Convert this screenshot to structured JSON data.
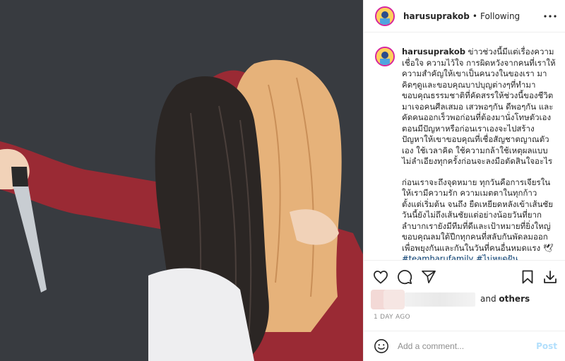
{
  "colors": {
    "accent": "#0095f6",
    "post_disabled": "#b2dffc",
    "muted": "#8e8e8e",
    "divider": "#efefef",
    "image_bg": "#383b40"
  },
  "post": {
    "image_alt": "illustration",
    "icons": [
      "knife-illustration"
    ]
  },
  "header": {
    "username": "harusuprakob",
    "separator": "•",
    "follow_status": "Following",
    "more_icon": "more-horizontal-icon"
  },
  "caption": {
    "username": "harusuprakob",
    "paragraph1": "ข่าวช่วงนี้มีแต่เรื่องความเชื่อใจ ความไว้ใจ การผิดหวังจากคนที่เราให้ความสำคัญให้เขาเป็นคนวงในของเรา มาคิดๆดูและขอบคุณบาปบุญต่างๆที่ทำมา ขอบคุณธรรมชาติที่คัดสรรให้ช่วงนี้ของชีวิตมาเจอคนศีลเสมอ เสวพอๆกัน ดีพอๆกัน และคัดคนออกเร็วพอก่อนที่ต้องมานั่งโทษตัวเองตอนมีปัญหาหรือก่อนเราเองจะไปสร้างปัญหาให้เขาขอบคุณที่เชื่อสัญชาตญาณตัวเอง ใช้เวลาคิด ใช้ความกล้าใช้เหตุผลแบบไม่ลำเอียงทุกครั้งก่อนจะลงมือตัดสินใจอะไร",
    "paragraph2": "ก่อนเราจะถึงจุดหมาย ทุกวันคือการเจียรในให้เรามีความรัก ความเมตตาในทุกก้าวตั้งแต่เริ่มต้น จนถึง ยืดเหยียดหลังเข้าเส้นชัย วันนี้ยังไม่ถึงเส้นชัยแต่อย่างน้อยวันที่ยากลำบากเรายังมีทีมที่ดีและเป้าหมายที่ยิ่งใหญ่ขอบคุณลมใต้ปีกทุกคนที่สลับกันพัดลมออกเพื่อพยุงกันและกันในวันที่คนอื่นหมดแรง 🕊",
    "hashtags": "#teamharufamily #ไม่หยุดฝัน"
  },
  "actions": {
    "like_icon": "heart-icon",
    "comment_icon": "comment-icon",
    "share_icon": "paper-plane-icon",
    "save_icon": "bookmark-icon"
  },
  "likes": {
    "and_label": "and",
    "others_label": "others"
  },
  "timestamp": "1 DAY AGO",
  "comment_box": {
    "emoji_icon": "smiley-icon",
    "placeholder": "Add a comment...",
    "post_label": "Post"
  }
}
